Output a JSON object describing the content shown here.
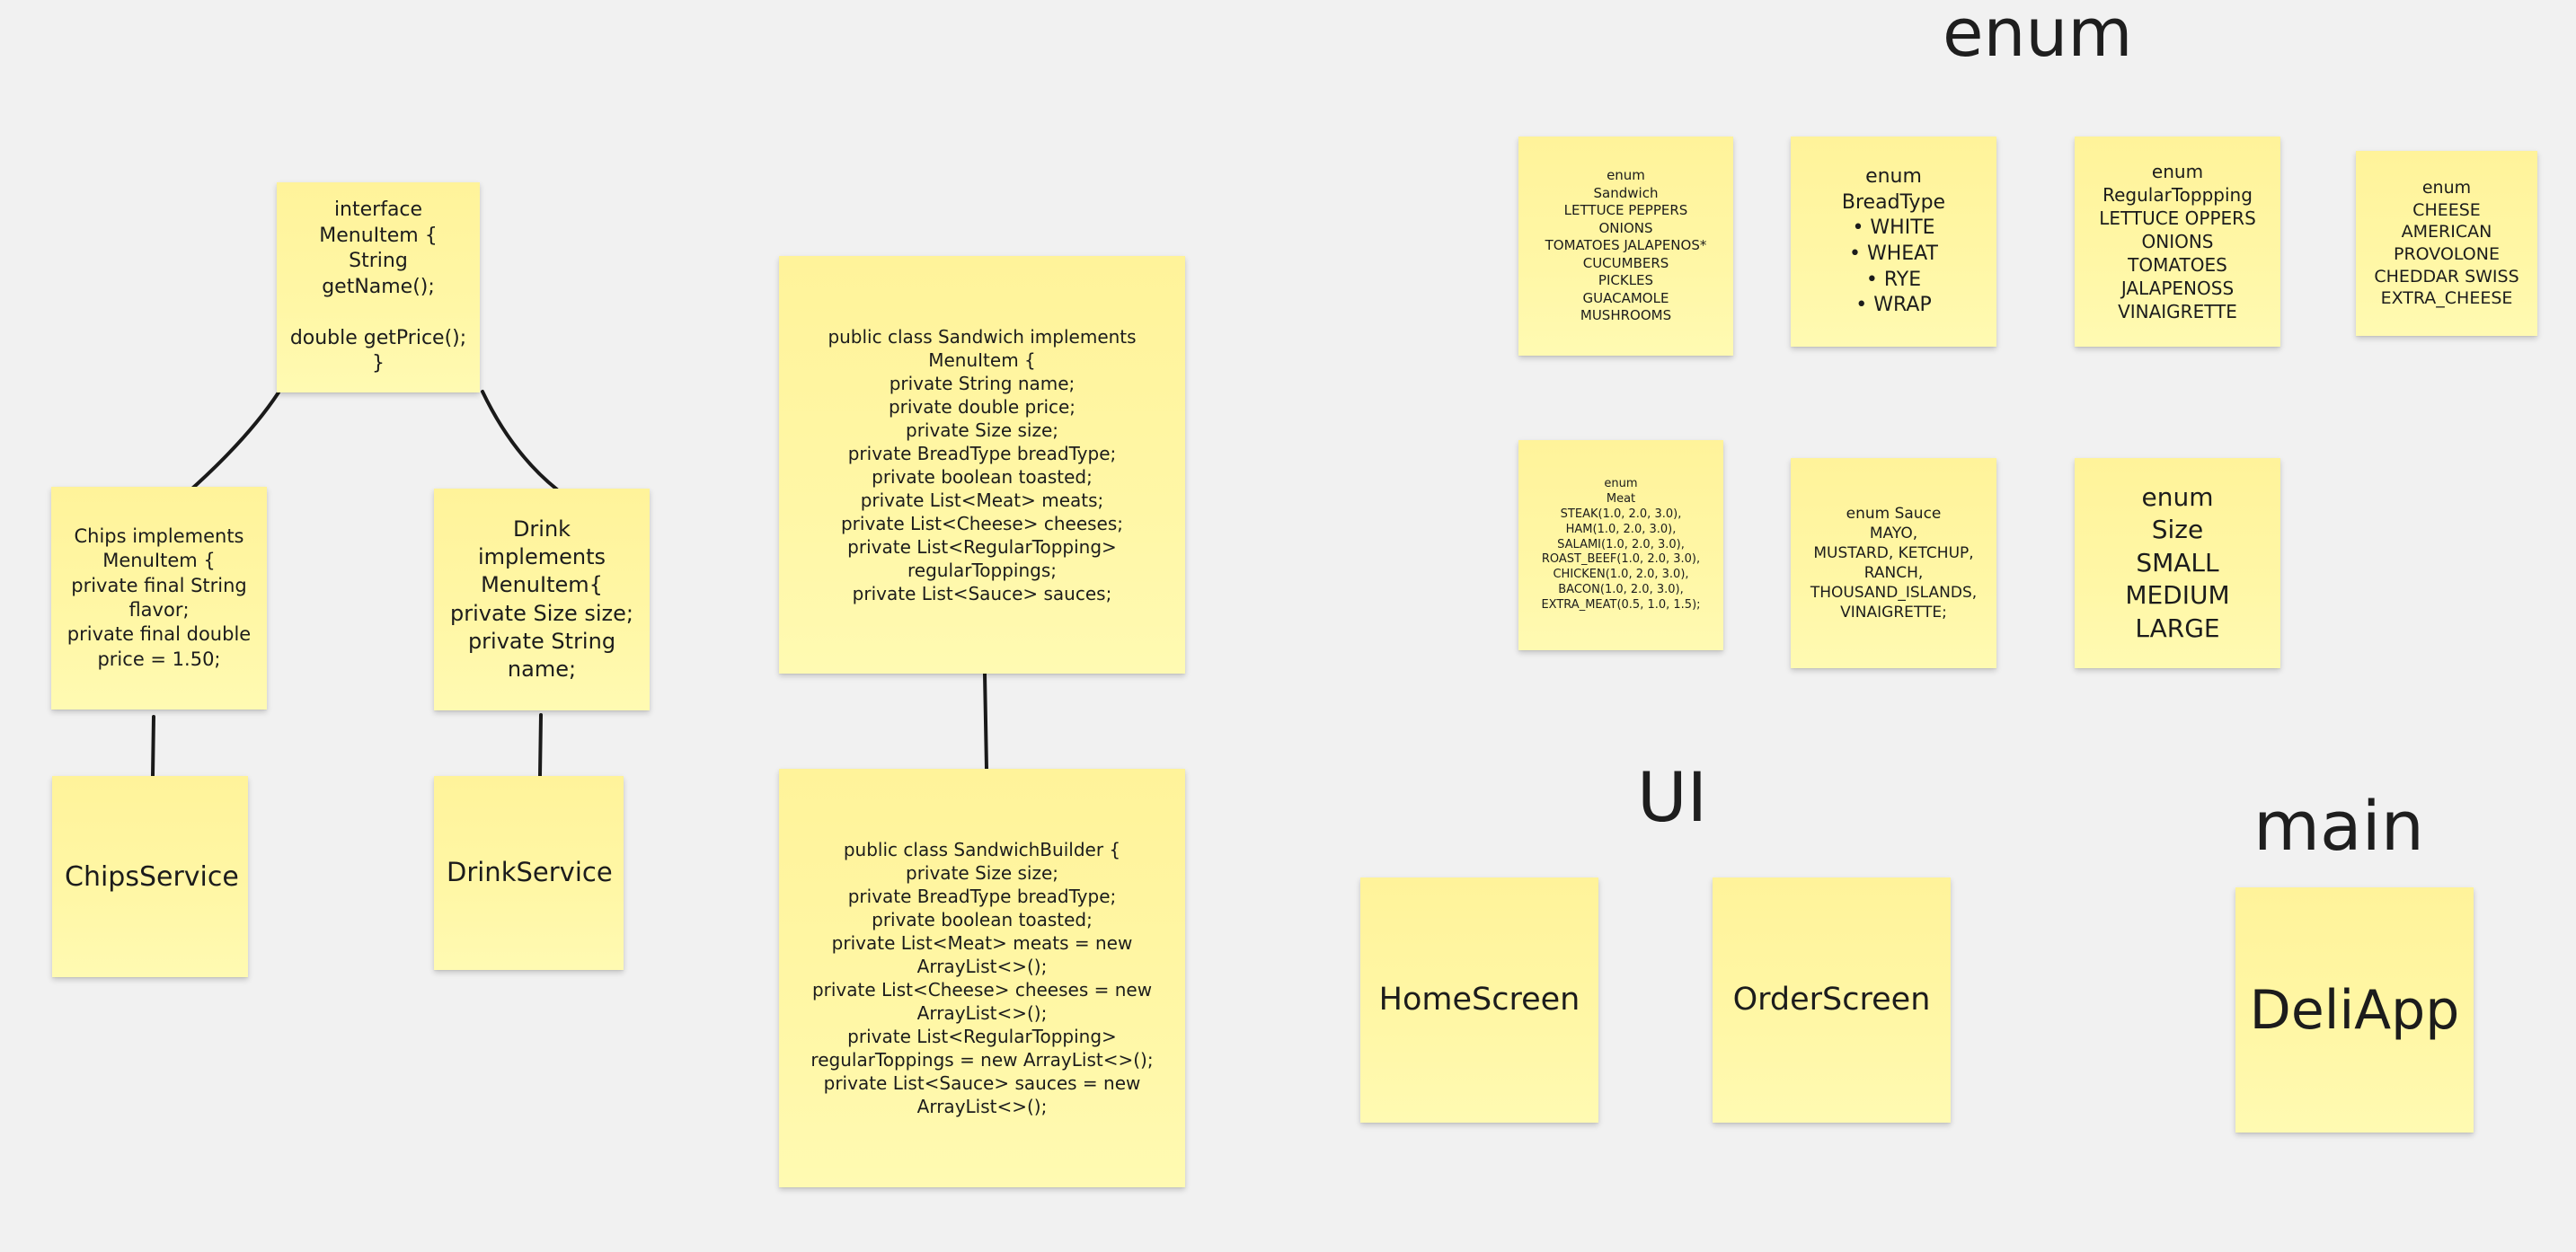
{
  "section_titles": {
    "enum": "enum",
    "ui": "UI",
    "main": "main"
  },
  "notes": {
    "interface_menuitem": "interface\nMenuItem {\nString getName();\n\ndouble getPrice();\n}",
    "chips": "Chips implements\nMenuItem {\nprivate final String\nflavor;\nprivate final double\nprice = 1.50;",
    "drink": "Drink\nimplements\nMenuItem{\nprivate Size size;\nprivate String\nname;",
    "chips_service": "ChipsService",
    "drink_service": "DrinkService",
    "sandwich_class": "public class Sandwich implements\nMenuItem {\nprivate String name;\nprivate double price;\nprivate Size size;\nprivate BreadType breadType;\nprivate boolean toasted;\nprivate List<Meat> meats;\nprivate List<Cheese> cheeses;\nprivate List<RegularTopping>\nregularToppings;\nprivate List<Sauce> sauces;",
    "sandwich_builder": "public class SandwichBuilder {\nprivate Size size;\nprivate BreadType breadType;\nprivate boolean toasted;\nprivate List<Meat> meats = new\nArrayList<>();\nprivate List<Cheese> cheeses = new\nArrayList<>();\nprivate List<RegularTopping>\nregularToppings = new ArrayList<>();\nprivate List<Sauce> sauces = new\nArrayList<>();",
    "enum_sandwich": "enum\nSandwich\nLETTUCE PEPPERS\nONIONS\nTOMATOES JALAPENOS*\nCUCUMBERS\nPICKLES\nGUACAMOLE\nMUSHROOMS",
    "enum_breadtype": "enum\nBreadType\n• WHITE\n• WHEAT\n• RYE\n• WRAP",
    "enum_regulartopping": "enum\nRegularToppping\nLETTUCE OPPERS\nONIONS\nTOMATOES\nJALAPENOSS\nVINAIGRETTE",
    "enum_cheese": "enum\nCHEESE\nAMERICAN\nPROVOLONE\nCHEDDAR SWISS\nEXTRA_CHEESE",
    "enum_meat": "enum\nMeat\nSTEAK(1.0, 2.0, 3.0),\nHAM(1.0, 2.0, 3.0),\nSALAMI(1.0, 2.0, 3.0),\nROAST_BEEF(1.0, 2.0, 3.0),\nCHICKEN(1.0, 2.0, 3.0),\nBACON(1.0, 2.0, 3.0),\nEXTRA_MEAT(0.5, 1.0, 1.5);",
    "enum_sauce": "enum Sauce\nMAYO,\nMUSTARD, KETCHUP,\nRANCH,\nTHOUSAND_ISLANDS,\nVINAIGRETTE;",
    "enum_size": "enum\nSize\nSMALL\nMEDIUM\nLARGE",
    "home_screen": "HomeScreen",
    "order_screen": "OrderScreen",
    "deli_app": "DeliApp"
  }
}
